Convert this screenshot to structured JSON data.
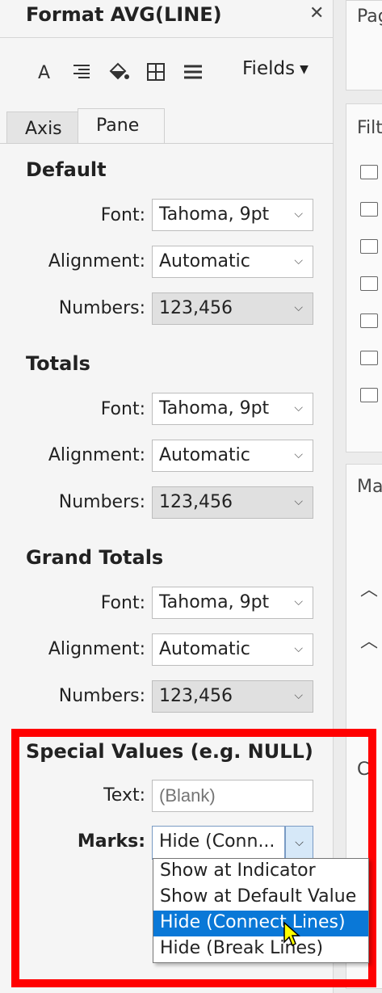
{
  "header": {
    "title": "Format AVG(LINE)",
    "close_glyph": "✕"
  },
  "toolbar": {
    "icons": [
      "font-icon",
      "alignment-icon",
      "shading-icon",
      "borders-icon",
      "lines-icon"
    ],
    "fields_label": "Fields",
    "fields_caret": "▼"
  },
  "tabs": [
    {
      "label": "Axis",
      "active": false
    },
    {
      "label": "Pane",
      "active": true
    }
  ],
  "sections": {
    "default": {
      "title": "Default",
      "font_label": "Font:",
      "font_value": "Tahoma, 9pt",
      "alignment_label": "Alignment:",
      "alignment_value": "Automatic",
      "numbers_label": "Numbers:",
      "numbers_value": "123,456"
    },
    "totals": {
      "title": "Totals",
      "font_label": "Font:",
      "font_value": "Tahoma, 9pt",
      "alignment_label": "Alignment:",
      "alignment_value": "Automatic",
      "numbers_label": "Numbers:",
      "numbers_value": "123,456"
    },
    "grand_totals": {
      "title": "Grand Totals",
      "font_label": "Font:",
      "font_value": "Tahoma, 9pt",
      "alignment_label": "Alignment:",
      "alignment_value": "Automatic",
      "numbers_label": "Numbers:",
      "numbers_value": "123,456"
    },
    "special_values": {
      "title": "Special Values (e.g. NULL)",
      "text_label": "Text:",
      "text_placeholder": "(Blank)",
      "marks_label": "Marks:",
      "marks_value": "Hide (Conn...",
      "options": [
        "Show at Indicator",
        "Show at Default Value",
        "Hide (Connect Lines)",
        "Hide (Break Lines)"
      ],
      "selected_index": 2
    }
  },
  "right_strip": {
    "pages_label": "Pag",
    "filters_label": "Filt",
    "marks_label": "Ma",
    "partial_c": "C"
  },
  "colors": {
    "highlight": "#ff0000",
    "selection": "#0a78d7"
  }
}
